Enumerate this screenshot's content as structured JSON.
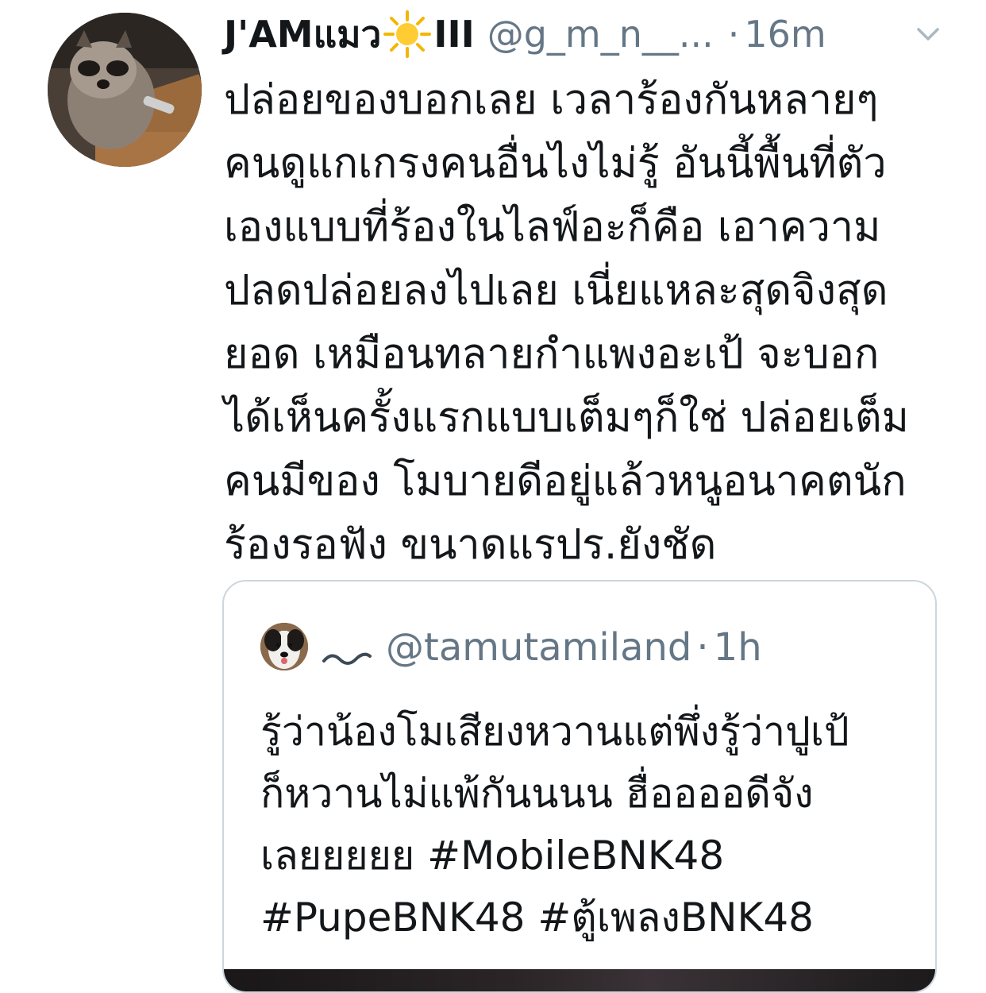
{
  "tweet": {
    "display_name": "J'AMแมว",
    "sun_emoji": "sun-icon",
    "name_suffix": "III",
    "handle": "@g_m_n__...",
    "separator": "·",
    "time": "16m",
    "text": "ปล่อยของบอกเลย เวลาร้องกันหลายๆ\nคนดูแกเกรงคนอื่นไงไม่รู้  อันนี้พื้นที่ตัว\nเองแบบที่ร้องในไลฟ์อะก็คือ เอาความ\nปลดปล่อยลงไปเลย เนี่ยแหละสุดจิงสุด\nยอด เหมือนทลายกำแพงอะเป้ จะบอก\nได้เห็นครั้งแรกแบบเต็มๆก็ใช่ ปล่อยเต็ม\nคนมีของ โมบายดีอยู่แล้วหนูอนาคตนัก\nร้องรอฟัง ขนาดแรปร.ยังชัด"
  },
  "quote": {
    "name_icon": "tilde-icon",
    "handle": "@tamutamiland",
    "separator": "·",
    "time": "1h",
    "text": "รู้ว่าน้องโมเสียงหวานแต่พึ่งรู้ว่าปูเป้\nก็หวานไม่แพ้กันนนน ฮื่ออออดีจัง\nเลยยยยย #MobileBNK48\n#PupeBNK48 #ตู้เพลงBNK48"
  },
  "colors": {
    "text": "#14171a",
    "secondary": "#657786",
    "border": "#ccd6dd",
    "background": "#ffffff"
  }
}
